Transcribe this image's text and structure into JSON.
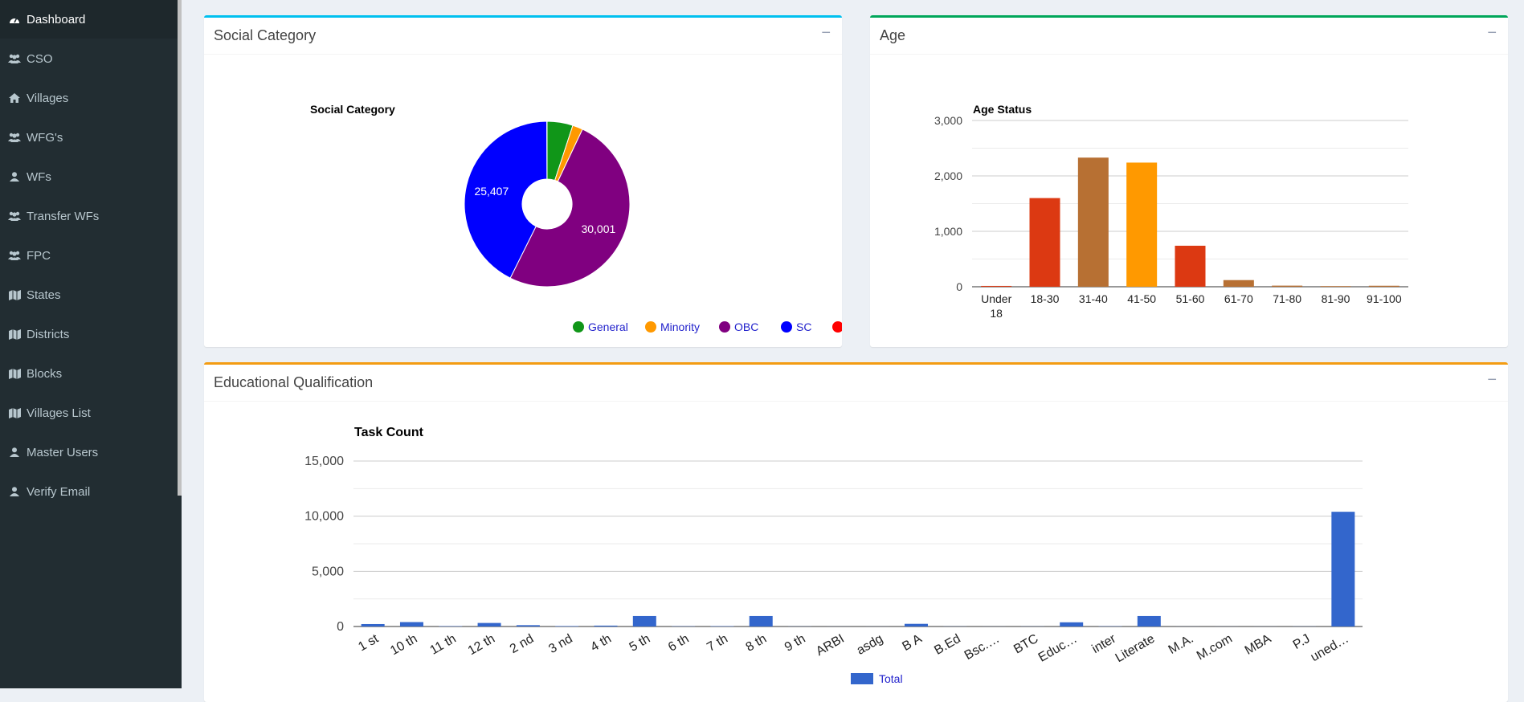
{
  "sidebar": {
    "items": [
      {
        "label": "Dashboard",
        "icon": "dashboard-icon"
      },
      {
        "label": "CSO",
        "icon": "users-icon"
      },
      {
        "label": "Villages",
        "icon": "home-icon"
      },
      {
        "label": "WFG's",
        "icon": "users-icon"
      },
      {
        "label": "WFs",
        "icon": "user-icon"
      },
      {
        "label": "Transfer WFs",
        "icon": "users-icon"
      },
      {
        "label": "FPC",
        "icon": "users-icon"
      },
      {
        "label": "States",
        "icon": "map-icon"
      },
      {
        "label": "Districts",
        "icon": "map-icon"
      },
      {
        "label": "Blocks",
        "icon": "map-icon"
      },
      {
        "label": "Villages List",
        "icon": "map-icon"
      },
      {
        "label": "Master Users",
        "icon": "user-icon"
      },
      {
        "label": "Verify Email",
        "icon": "user-icon"
      }
    ]
  },
  "panels": {
    "social": {
      "title": "Social Category",
      "collapse": "−",
      "accent": "#00c0ef"
    },
    "age": {
      "title": "Age",
      "collapse": "−",
      "accent": "#00a65a"
    },
    "edu": {
      "title": "Educational Qualification",
      "collapse": "−",
      "accent": "#f39c12"
    }
  },
  "chart_data": [
    {
      "type": "pie",
      "title": "Social Category",
      "categories": [
        "General",
        "Minority",
        "OBC",
        "SC",
        "ST"
      ],
      "values": [
        3000,
        1200,
        30001,
        25407,
        30
      ],
      "colors": [
        "#109618",
        "#ff9900",
        "#800080",
        "#0000ff",
        "#ff0000"
      ],
      "data_labels": [
        "",
        "",
        "30,001",
        "25,407",
        ""
      ],
      "legend": "bottom"
    },
    {
      "type": "bar",
      "title": "Age Status",
      "categories": [
        "Under 18",
        "18-30",
        "31-40",
        "41-50",
        "51-60",
        "61-70",
        "71-80",
        "81-90",
        "91-100"
      ],
      "values": [
        15,
        1600,
        2330,
        2240,
        740,
        120,
        20,
        12,
        18
      ],
      "colors": [
        "#dc3912",
        "#dc3912",
        "#b77033",
        "#ff9900",
        "#dc3912",
        "#b77033",
        "#b77033",
        "#b77033",
        "#b77033"
      ],
      "yticks": [
        "0",
        "1,000",
        "2,000",
        "3,000"
      ],
      "ylim": [
        0,
        3000
      ],
      "grid": true
    },
    {
      "type": "bar",
      "title": "Task Count",
      "categories": [
        "1 st",
        "10 th",
        "11 th",
        "12 th",
        "2 nd",
        "3 nd",
        "4 th",
        "5 th",
        "6 th",
        "7 th",
        "8 th",
        "9 th",
        "ARBI",
        "asdg",
        "B A",
        "B.Ed",
        "Bsc.…",
        "BTC",
        "Educ…",
        "inter",
        "Literate",
        "M.A.",
        "M.com",
        "MBA",
        "P.J",
        "uned…"
      ],
      "series": [
        {
          "name": "Total",
          "color": "#3366cc",
          "values": [
            220,
            400,
            30,
            320,
            120,
            40,
            80,
            950,
            20,
            30,
            950,
            10,
            5,
            5,
            240,
            10,
            5,
            10,
            380,
            20,
            950,
            5,
            5,
            5,
            10,
            10400
          ]
        }
      ],
      "yticks": [
        "0",
        "5,000",
        "10,000",
        "15,000"
      ],
      "ylim": [
        0,
        15000
      ],
      "grid": true,
      "legend": "bottom"
    }
  ]
}
